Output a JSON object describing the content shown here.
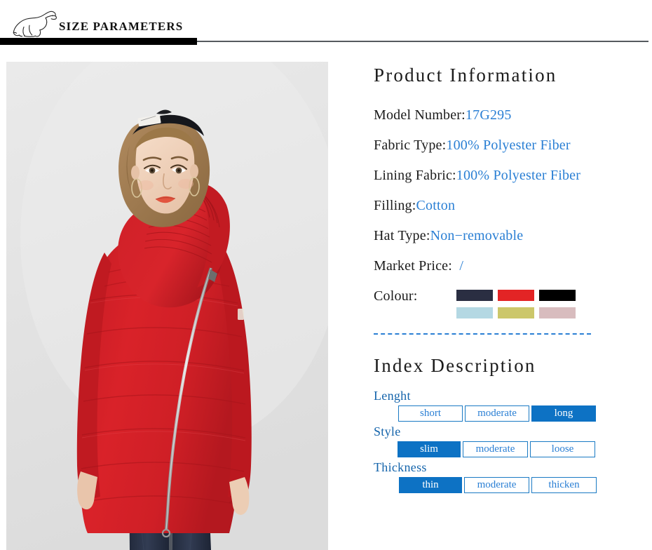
{
  "header": {
    "title": "SIZE PARAMETERS",
    "logo_icon": "polar-bear-logo-icon"
  },
  "product_photo": {
    "alt": "model wearing red hooded quilted parka coat with diagonal zipper",
    "background_color": "#e3e3e3",
    "coat_color": "#d21f28",
    "jeans_color": "#2b3245"
  },
  "product_information": {
    "heading": "Product Information",
    "specs": [
      {
        "label": "Model Number:",
        "value": "17G295"
      },
      {
        "label": "Fabric Type:",
        "value": "100% Polyester Fiber"
      },
      {
        "label": "Lining Fabric:",
        "value": "100% Polyester Fiber"
      },
      {
        "label": "Filling:",
        "value": "Cotton"
      },
      {
        "label": "Hat Type:",
        "value": "Non−removable"
      },
      {
        "label": "Market Price:",
        "value": "/"
      }
    ],
    "colour": {
      "label": "Colour:",
      "swatches": [
        {
          "name": "navy",
          "hex": "#2a2e42"
        },
        {
          "name": "red",
          "hex": "#e32425"
        },
        {
          "name": "black",
          "hex": "#000000"
        },
        {
          "name": "light-blue",
          "hex": "#b4d8e3"
        },
        {
          "name": "olive-yellow",
          "hex": "#ccc76a"
        },
        {
          "name": "dusty-pink",
          "hex": "#d8bcbe"
        }
      ]
    }
  },
  "index_description": {
    "heading": "Index Description",
    "groups": [
      {
        "label": "Lenght",
        "options": [
          {
            "label": "short",
            "selected": false
          },
          {
            "label": "moderate",
            "selected": false
          },
          {
            "label": "long",
            "selected": true
          }
        ]
      },
      {
        "label": "Style",
        "options": [
          {
            "label": "slim",
            "selected": true
          },
          {
            "label": "moderate",
            "selected": false
          },
          {
            "label": "loose",
            "selected": false
          }
        ]
      },
      {
        "label": "Thickness",
        "options": [
          {
            "label": "thin",
            "selected": true
          },
          {
            "label": "moderate",
            "selected": false
          },
          {
            "label": "thicken",
            "selected": false
          }
        ]
      }
    ]
  },
  "colors": {
    "accent_blue": "#2a7fd4",
    "selected_blue": "#0d72c4",
    "group_label_blue": "#1464ab",
    "text_dark": "#1b1b1b",
    "rule_black": "#000000",
    "rule_gray": "#555a5f"
  }
}
